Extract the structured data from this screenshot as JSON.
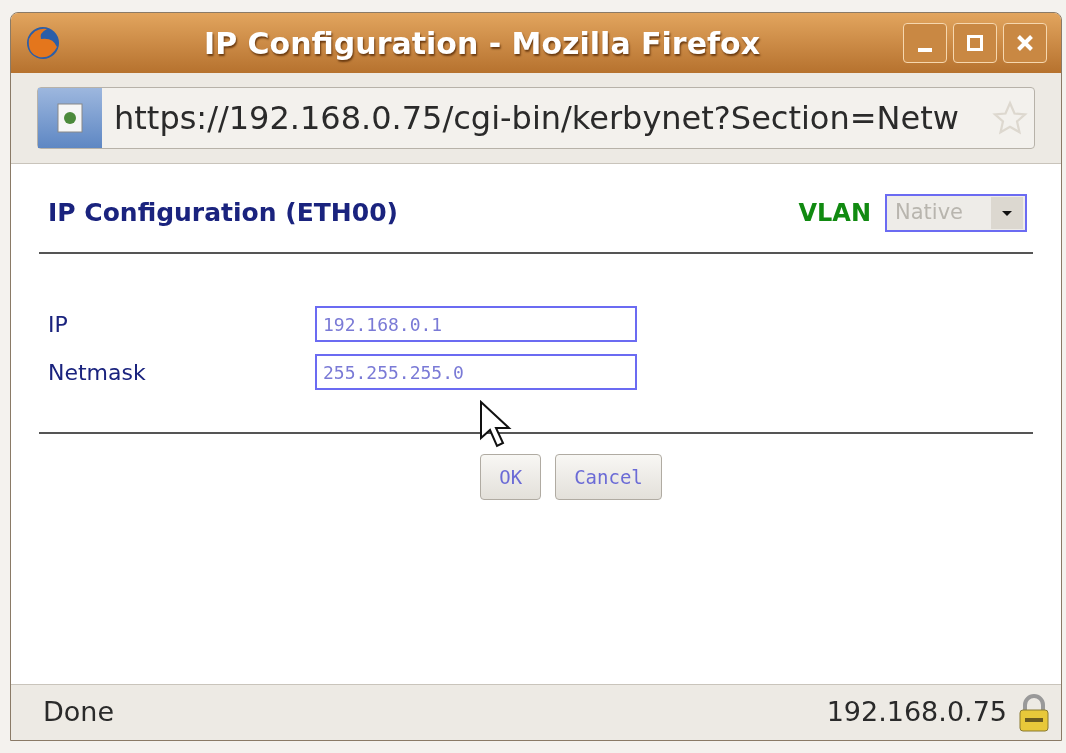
{
  "window": {
    "title": "IP Configuration - Mozilla Firefox"
  },
  "address_bar": {
    "url": "https://192.168.0.75/cgi-bin/kerbynet?Section=Netw"
  },
  "page": {
    "heading": "IP Configuration (ETH00)",
    "vlan": {
      "label": "VLAN",
      "value": "Native",
      "disabled": true
    },
    "fields": [
      {
        "label": "IP",
        "value": "192.168.0.1"
      },
      {
        "label": "Netmask",
        "value": "255.255.255.0"
      }
    ],
    "buttons": [
      "OK",
      "Cancel"
    ]
  },
  "status_bar": {
    "text": "Done",
    "host": "192.168.0.75"
  }
}
